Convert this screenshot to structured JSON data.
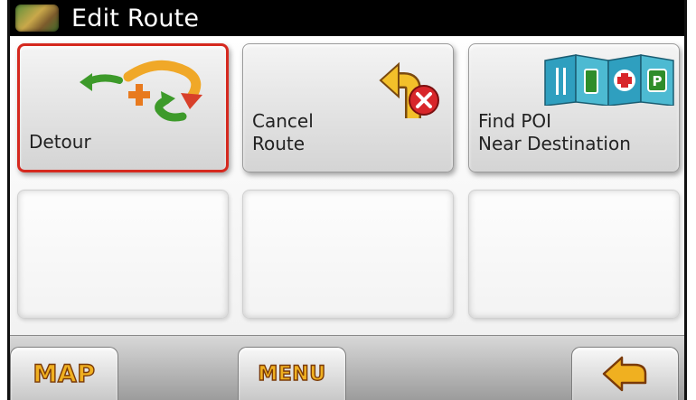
{
  "header": {
    "title": "Edit Route",
    "icon": "app-map-icon"
  },
  "tiles": [
    {
      "label": "Detour",
      "icon": "detour-arrows-icon",
      "selected": true
    },
    {
      "label": "Cancel\nRoute",
      "icon": "cancel-route-icon",
      "selected": false
    },
    {
      "label": "Find POI\nNear Destination",
      "icon": "poi-map-icon",
      "selected": false
    }
  ],
  "bottom": {
    "map_label": "MAP",
    "menu_label": "MENU",
    "back_icon": "back-arrow-icon"
  },
  "colors": {
    "selection": "#d5291f",
    "softkey_text": "#f0b020",
    "titlebar": "#000000"
  }
}
